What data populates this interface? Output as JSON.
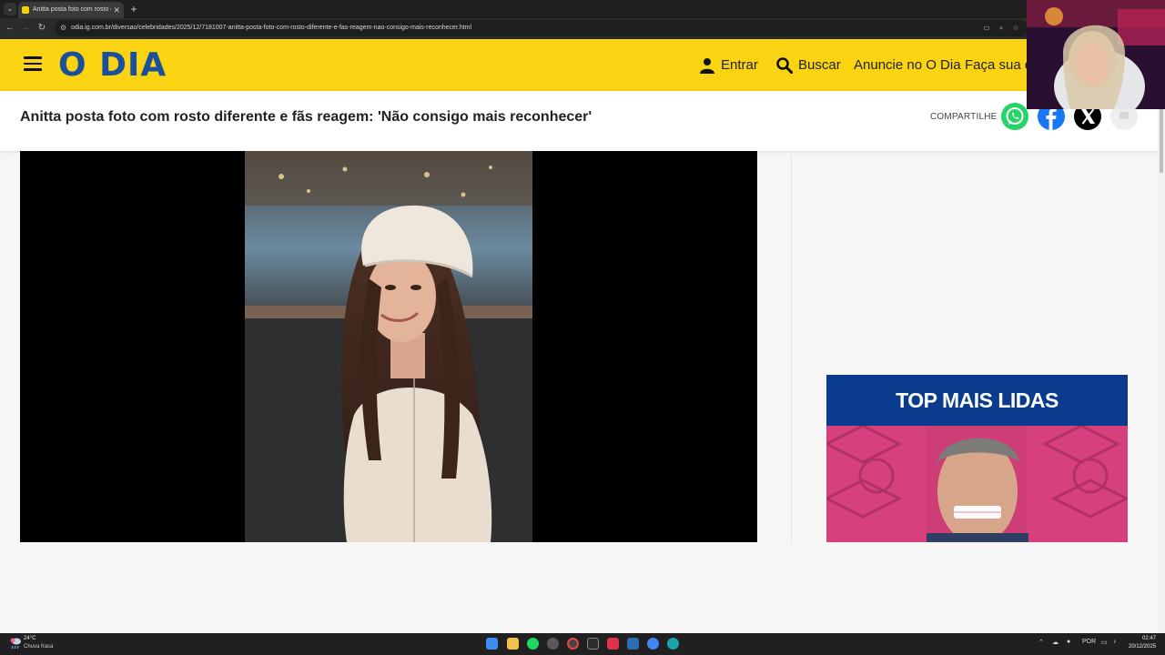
{
  "browser": {
    "tab_title": "Anitta posta foto com rosto dife",
    "tab_close": "✕",
    "new_tab": "+",
    "url": "odia.ig.com.br/diversao/celebridades/2025/12/7181007-anitta-posta-foto-com-rosto-diferente-e-fas-reagem-nao-consigo-mais-reconhecer.html"
  },
  "site": {
    "logo": "O DIA",
    "brand_color": "#fad412",
    "logo_color": "#1a4f9c",
    "nav": {
      "login": "Entrar",
      "search": "Buscar",
      "advertise": "Anuncie no O Dia",
      "subscribe": "Faça sua de"
    }
  },
  "article": {
    "title": "Anitta posta foto com rosto diferente e fãs reagem: 'Não consigo mais reconhecer'",
    "share_label": "COMPARTILHE",
    "share_buttons": [
      {
        "name": "whatsapp",
        "color": "#25d366"
      },
      {
        "name": "facebook",
        "color": "#1877f2"
      },
      {
        "name": "x",
        "color": "#000000"
      },
      {
        "name": "more",
        "color": "#eeeeee"
      }
    ]
  },
  "sidebar": {
    "top_read_title": "TOP MAIS LIDAS",
    "top_read_color": "#0b3b8c"
  },
  "taskbar": {
    "temperature": "24°C",
    "weather": "Chuva fraca",
    "language": "POR",
    "time": "02:47",
    "date": "20/12/2025"
  }
}
